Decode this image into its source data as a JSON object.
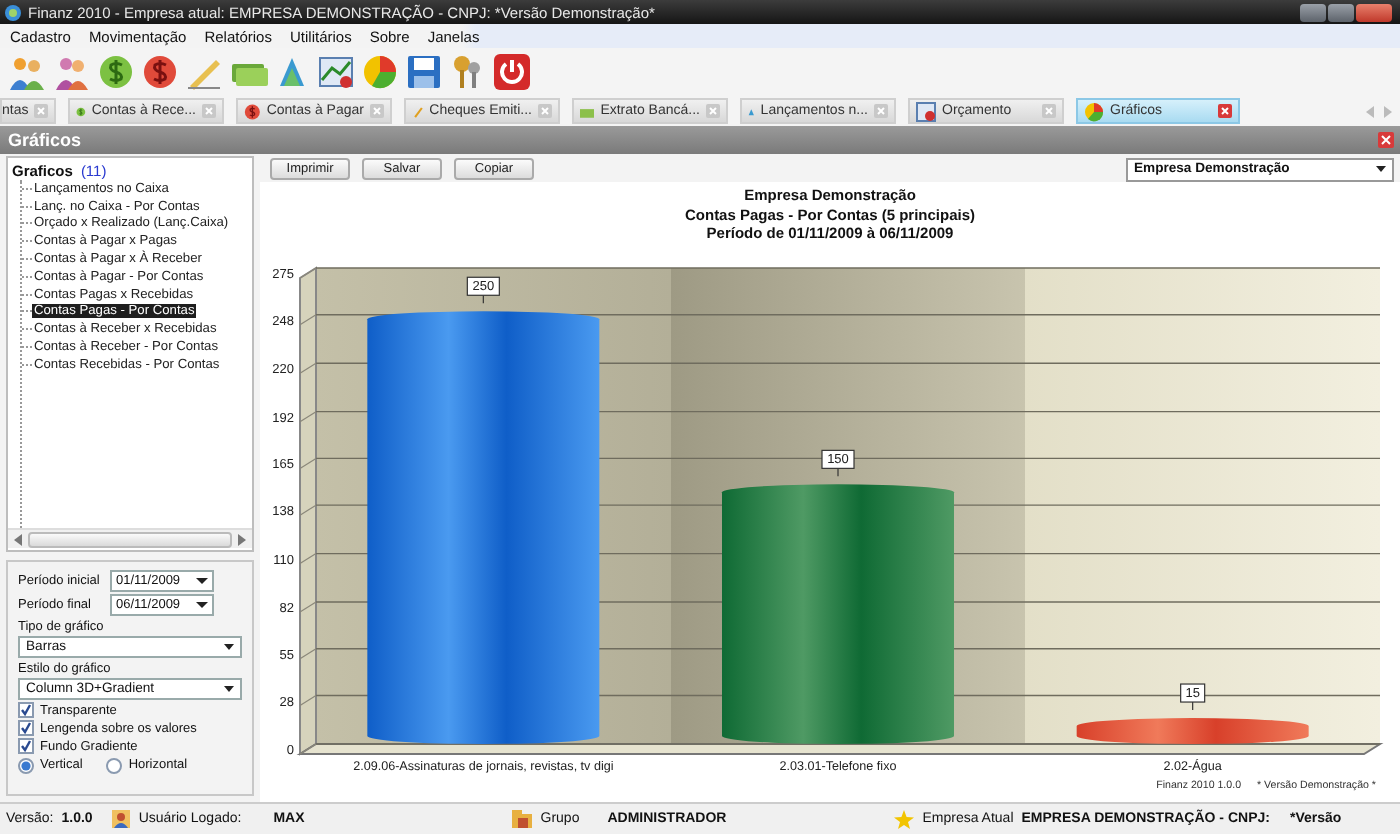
{
  "window": {
    "title": "Finanz 2010 - Empresa atual: EMPRESA DEMONSTRAÇÃO - CNPJ: *Versão Demonstração*"
  },
  "menu": [
    "Cadastro",
    "Movimentação",
    "Relatórios",
    "Utilitários",
    "Sobre",
    "Janelas"
  ],
  "tabs": [
    {
      "label": "ntas",
      "kind": "cut",
      "selected": false
    },
    {
      "label": "Contas à Rece...",
      "kind": "receivable",
      "selected": false
    },
    {
      "label": "Contas à Pagar",
      "kind": "payable",
      "selected": false
    },
    {
      "label": "Cheques Emiti...",
      "kind": "cheque",
      "selected": false
    },
    {
      "label": "Extrato Bancá...",
      "kind": "bank",
      "selected": false
    },
    {
      "label": "Lançamentos n...",
      "kind": "entries",
      "selected": false
    },
    {
      "label": "Orçamento",
      "kind": "budget",
      "selected": false
    },
    {
      "label": "Gráficos",
      "kind": "charts",
      "selected": true
    }
  ],
  "panel": {
    "title": "Gráficos"
  },
  "tree": {
    "label": "Graficos",
    "count": "(11)",
    "children": [
      {
        "label": "Lançamentos no Caixa",
        "selected": false
      },
      {
        "label": "Lanç. no Caixa - Por Contas",
        "selected": false
      },
      {
        "label": "Orçado x Realizado (Lanç.Caixa)",
        "selected": false
      },
      {
        "label": "Contas à Pagar x Pagas",
        "selected": false
      },
      {
        "label": "Contas à Pagar x À Receber",
        "selected": false
      },
      {
        "label": "Contas à Pagar - Por Contas",
        "selected": false
      },
      {
        "label": "Contas Pagas x Recebidas",
        "selected": false
      },
      {
        "label": "Contas Pagas - Por Contas",
        "selected": true
      },
      {
        "label": "Contas à Receber x Recebidas",
        "selected": false
      },
      {
        "label": "Contas à Receber - Por Contas",
        "selected": false
      },
      {
        "label": "Contas Recebidas - Por Contas",
        "selected": false
      }
    ]
  },
  "options": {
    "period_start": {
      "label": "Período inicial",
      "value": "01/11/2009"
    },
    "period_end": {
      "label": "Período final",
      "value": "06/11/2009"
    },
    "chart_type": {
      "label": "Tipo de gráfico",
      "value": "Barras"
    },
    "chart_style": {
      "label": "Estilo do gráfico",
      "value": "Column 3D+Gradient"
    },
    "checkboxes": [
      {
        "label": "Transparente",
        "checked": true
      },
      {
        "label": "Lengenda sobre os valores",
        "checked": true
      },
      {
        "label": "Fundo Gradiente",
        "checked": true
      }
    ],
    "orientation": [
      {
        "label": "Vertical",
        "selected": true
      },
      {
        "label": "Horizontal",
        "selected": false
      }
    ]
  },
  "chart_toolbar": {
    "buttons": [
      "Imprimir",
      "Salvar",
      "Copiar"
    ],
    "company": "Empresa Demonstração"
  },
  "chart": {
    "title_lines": [
      "Empresa Demonstração",
      "Contas Pagas - Por Contas (5 principais)",
      "Período de 01/11/2009 à 06/11/2009"
    ],
    "chart_data": {
      "type": "bar",
      "categories": [
        "2.09.06-Assinaturas de jornais, revistas, tv digi",
        "2.03.01-Telefone fixo",
        "2.02-Água"
      ],
      "values": [
        250,
        150,
        15
      ],
      "ylim": [
        0,
        275
      ],
      "yticks": [
        0,
        28,
        55,
        82,
        110,
        138,
        165,
        192,
        220,
        248,
        275
      ],
      "data_labels": true,
      "grid": true
    },
    "footer": [
      "Finanz 2010  1.0.0",
      "* Versão Demonstração *"
    ]
  },
  "status_bar": {
    "version_label": "Versão:",
    "version": "1.0.0",
    "user_label": "Usuário Logado:",
    "user": "MAX",
    "group_label": "Grupo",
    "group": "ADMINISTRADOR",
    "company_label": "Empresa Atual",
    "company": "EMPRESA DEMONSTRAÇÃO - CNPJ:",
    "note": "*Versão"
  }
}
